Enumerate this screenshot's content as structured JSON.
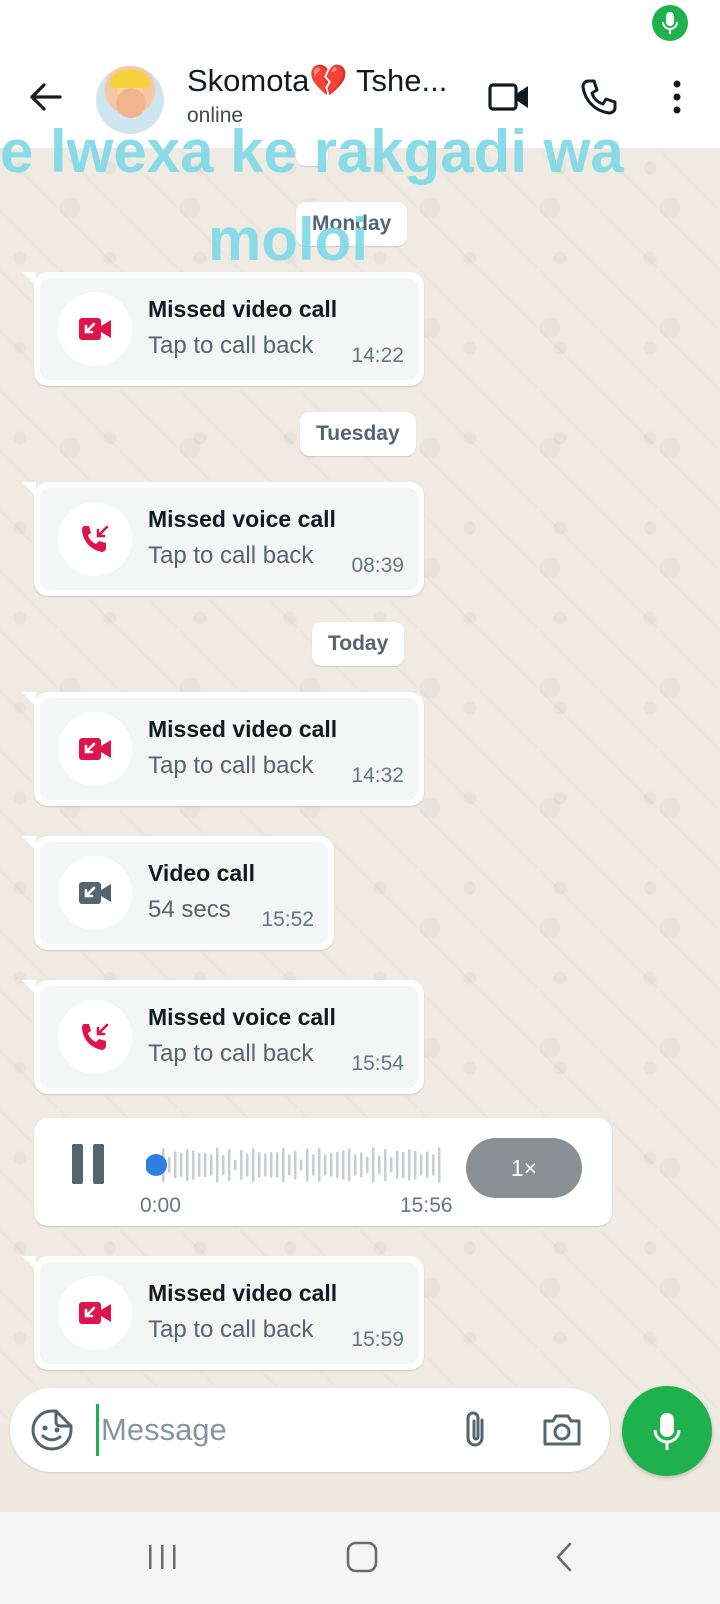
{
  "status_bar": {
    "mic_indicator": "mic-icon",
    "accent": "#1fb14e"
  },
  "header": {
    "contact_name": "Skomota💔 Tshe...",
    "contact_status": "online",
    "icons": [
      "back-arrow-icon",
      "video-call-icon",
      "voice-call-icon",
      "more-vert-icon"
    ]
  },
  "overlay_caption": {
    "line1": "e lwexa ke rakgadi wa",
    "line2": "moloi"
  },
  "date_chips": {
    "monday": "Monday",
    "tuesday": "Tuesday",
    "today": "Today"
  },
  "messages": [
    {
      "type": "call",
      "title": "Missed video call",
      "subtitle": "Tap to call back",
      "time": "14:22",
      "icon": "missed-video-call-icon"
    },
    {
      "type": "call",
      "title": "Missed voice call",
      "subtitle": "Tap to call back",
      "time": "08:39",
      "icon": "missed-voice-call-icon"
    },
    {
      "type": "call",
      "title": "Missed video call",
      "subtitle": "Tap to call back",
      "time": "14:32",
      "icon": "missed-video-call-icon"
    },
    {
      "type": "call",
      "title": "Video call",
      "subtitle": "54 secs",
      "time": "15:52",
      "icon": "video-call-icon"
    },
    {
      "type": "call",
      "title": "Missed voice call",
      "subtitle": "Tap to call back",
      "time": "15:54",
      "icon": "missed-voice-call-icon"
    },
    {
      "type": "call",
      "title": "Missed video call",
      "subtitle": "Tap to call back",
      "time": "15:59",
      "icon": "missed-video-call-icon"
    }
  ],
  "audio": {
    "elapsed": "0:00",
    "time": "15:56",
    "speed": "1×",
    "progress": 0.0
  },
  "composer": {
    "placeholder": "Message",
    "value": ""
  },
  "colors": {
    "missed": "#e0144c",
    "green": "#1fb14e",
    "bubble_inner": "#f4f5f5"
  }
}
